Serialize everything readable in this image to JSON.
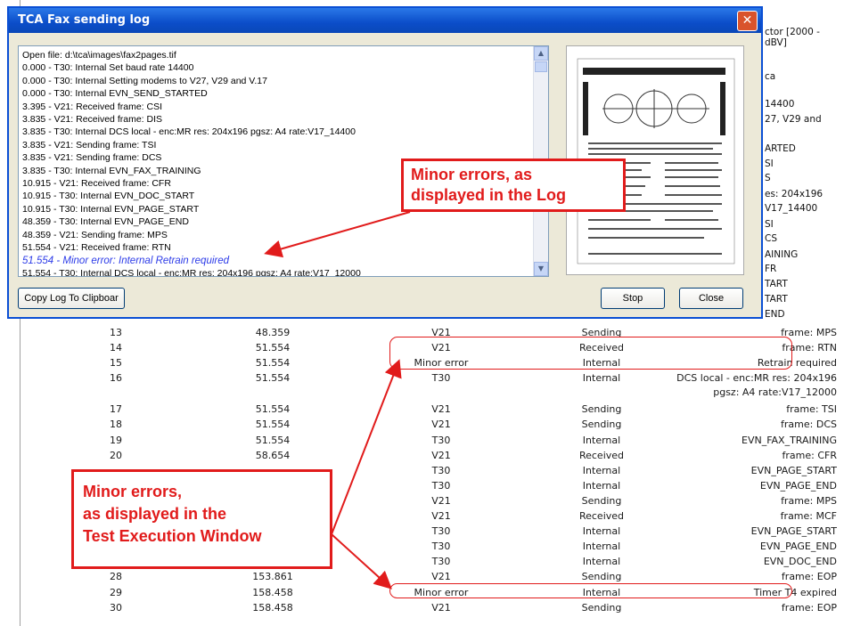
{
  "dialog": {
    "title": "TCA Fax sending log",
    "close_glyph": "✕",
    "log_lines": [
      "Open file: d:\\tca\\images\\fax2pages.tif",
      "0.000 - T30: Internal Set baud rate 14400",
      "0.000 - T30: Internal Setting modems to V27, V29 and V.17",
      "0.000 - T30: Internal EVN_SEND_STARTED",
      "3.395 - V21: Received frame: CSI",
      "3.835 - V21: Received frame: DIS",
      "3.835 - T30: Internal DCS local - enc:MR res: 204x196  pgsz:  A4   rate:V17_14400",
      "3.835 - V21: Sending frame: TSI",
      "3.835 - V21: Sending frame: DCS",
      "3.835 - T30: Internal EVN_FAX_TRAINING",
      "10.915 - V21: Received frame: CFR",
      "10.915 - T30: Internal EVN_DOC_START",
      "10.915 - T30: Internal EVN_PAGE_START",
      "48.359 - T30: Internal EVN_PAGE_END",
      "48.359 - V21: Sending frame: MPS",
      "51.554 - V21: Received frame: RTN",
      "51.554 - Minor error: Internal Retrain required",
      "51.554 - T30: Internal DCS local - enc:MR res: 204x196  pgsz:  A4   rate:V17_12000"
    ],
    "copy_button": "Copy Log To Clipboar",
    "stop_button": "Stop",
    "close_button": "Close"
  },
  "callouts": {
    "log": [
      "Minor errors, as",
      "displayed in the Log"
    ],
    "window": [
      "Minor errors,",
      "as displayed in the",
      "Test Execution Window"
    ]
  },
  "peek_text": [
    "ctor [2000 -",
    "dBV]",
    "ca",
    "14400",
    "27, V29 and",
    "ARTED",
    "SI",
    "S",
    "es: 204x196",
    "V17_14400",
    "SI",
    "CS",
    "AINING",
    "FR",
    "TART",
    "TART",
    "END"
  ],
  "table_rows": [
    {
      "n": "13",
      "t": "48.359",
      "a": "V21",
      "b": "Sending",
      "c": "frame: MPS"
    },
    {
      "n": "14",
      "t": "51.554",
      "a": "V21",
      "b": "Received",
      "c": "frame: RTN"
    },
    {
      "n": "15",
      "t": "51.554",
      "a": "Minor error",
      "b": "Internal",
      "c": "Retrain required"
    },
    {
      "n": "16",
      "t": "51.554",
      "a": "T30",
      "b": "Internal",
      "c": "DCS local - enc:MR res: 204x196",
      "c2": "pgsz:  A4   rate:V17_12000"
    },
    {
      "n": "17",
      "t": "51.554",
      "a": "V21",
      "b": "Sending",
      "c": "frame: TSI"
    },
    {
      "n": "18",
      "t": "51.554",
      "a": "V21",
      "b": "Sending",
      "c": "frame: DCS"
    },
    {
      "n": "19",
      "t": "51.554",
      "a": "T30",
      "b": "Internal",
      "c": "EVN_FAX_TRAINING"
    },
    {
      "n": "20",
      "t": "58.654",
      "a": "V21",
      "b": "Received",
      "c": "frame: CFR"
    },
    {
      "n": "",
      "t": "",
      "a": "T30",
      "b": "Internal",
      "c": "EVN_PAGE_START"
    },
    {
      "n": "",
      "t": "",
      "a": "T30",
      "b": "Internal",
      "c": "EVN_PAGE_END"
    },
    {
      "n": "",
      "t": "",
      "a": "V21",
      "b": "Sending",
      "c": "frame: MPS"
    },
    {
      "n": "",
      "t": "",
      "a": "V21",
      "b": "Received",
      "c": "frame: MCF"
    },
    {
      "n": "",
      "t": "",
      "a": "T30",
      "b": "Internal",
      "c": "EVN_PAGE_START"
    },
    {
      "n": "",
      "t": "",
      "a": "T30",
      "b": "Internal",
      "c": "EVN_PAGE_END"
    },
    {
      "n": "",
      "t": "",
      "a": "T30",
      "b": "Internal",
      "c": "EVN_DOC_END"
    },
    {
      "n": "28",
      "t": "153.861",
      "a": "V21",
      "b": "Sending",
      "c": "frame: EOP"
    },
    {
      "n": "29",
      "t": "158.458",
      "a": "Minor error",
      "b": "Internal",
      "c": "Timer T4 expired"
    },
    {
      "n": "30",
      "t": "158.458",
      "a": "V21",
      "b": "Sending",
      "c": "frame: EOP"
    }
  ],
  "colors": {
    "accent_red": "#e11b1b",
    "error_blue": "#2c3be8",
    "titlebar": "#0b4dc9"
  }
}
